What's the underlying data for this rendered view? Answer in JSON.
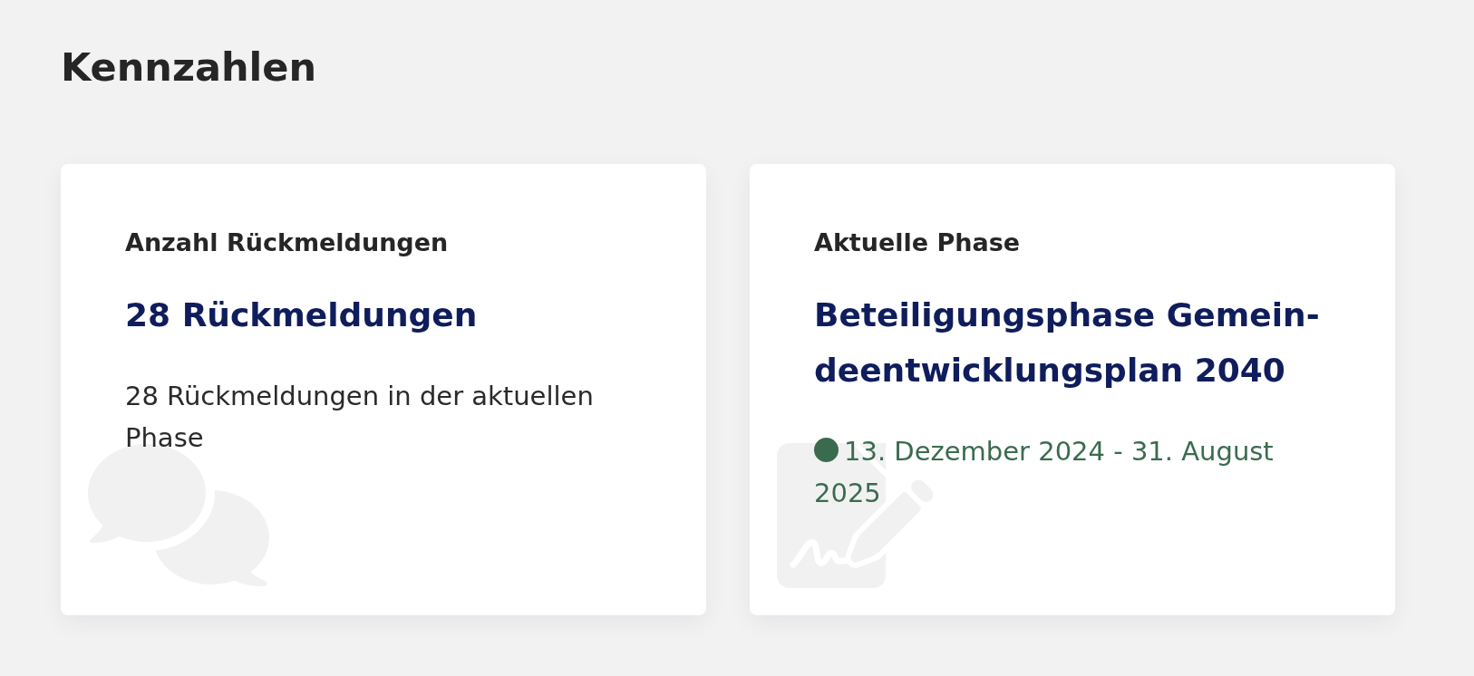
{
  "heading": "Kennzahlen",
  "cards": [
    {
      "kind": "feedback",
      "label": "Anzahl Rückmeldungen",
      "value": "28 Rückmeldungen",
      "description": "28 Rückmeldungen in der aktuellen Phase"
    },
    {
      "kind": "phase",
      "label": "Aktuelle Phase",
      "value": "Beteiligungsphase Gemein-deentwicklungsplan 2040",
      "period": "13. Dezember 2024 - 31. August 2025",
      "active": true
    }
  ]
}
